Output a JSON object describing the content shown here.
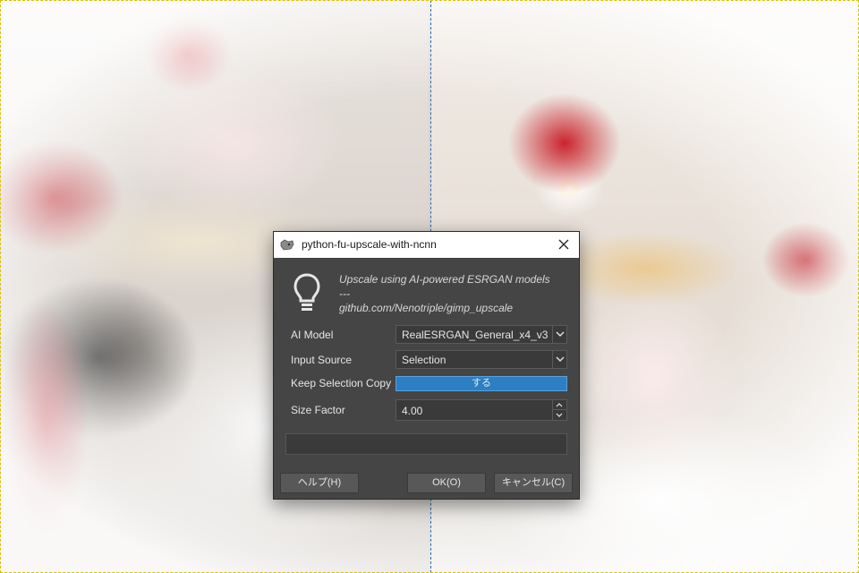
{
  "dialog": {
    "title": "python-fu-upscale-with-ncnn",
    "description": {
      "line1": "Upscale using AI-powered ESRGAN models",
      "line2": "---",
      "line3": "github.com/Nenotriple/gimp_upscale"
    },
    "fields": {
      "ai_model": {
        "label": "AI Model",
        "value": "RealESRGAN_General_x4_v3"
      },
      "input_source": {
        "label": "Input Source",
        "value": "Selection"
      },
      "keep_selection_copy": {
        "label": "Keep Selection Copy",
        "value": "する"
      },
      "size_factor": {
        "label": "Size Factor",
        "value": "4.00"
      }
    },
    "buttons": {
      "help": "ヘルプ(H)",
      "ok": "OK(O)",
      "cancel": "キャンセル(C)"
    }
  },
  "colors": {
    "dialog_bg": "#454545",
    "toggle_on": "#2c7fc2",
    "guide_line": "#2d6bb0",
    "selection_marching_ants": "#d8c000"
  },
  "icons": {
    "title": "gimp-wilber-icon",
    "info": "lightbulb-icon",
    "close": "close-icon",
    "dropdown": "chevron-down-icon",
    "spin_up": "chevron-up-icon",
    "spin_down": "chevron-down-icon"
  }
}
